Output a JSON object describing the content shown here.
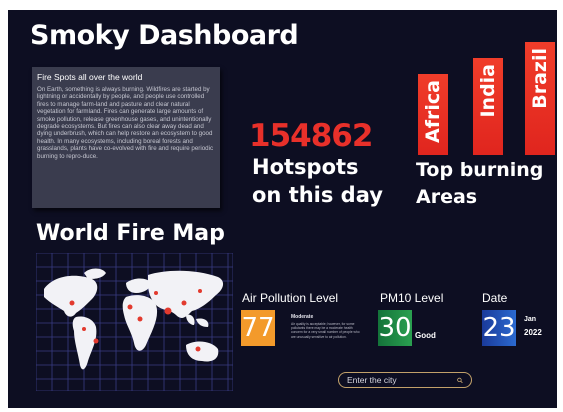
{
  "dashboard": {
    "title": "Smoky Dashboard"
  },
  "fire_card": {
    "heading": "Fire Spots all over the world",
    "body": "On Earth, something is always burning. Wildfires are started by lightning or accidentally by people, and people use controlled fires to manage farm-land and pasture and clear natural vegetation for farmland. Fires can generate large amounts of smoke pollution, release greenhouse gases, and unintentionally degrade ecosystems. But fires can also clear away dead and dying underbrush, which can help restore an ecosystem to good health. In many ecosystems, including boreal forests and grasslands, plants have co-evolved with fire and require periodic burning to repro-duce."
  },
  "hotspots": {
    "count": "154862",
    "caption_line1": "Hotspots",
    "caption_line2": "on this day"
  },
  "top_burning": {
    "bars": [
      {
        "label": "Africa",
        "level": 0.72
      },
      {
        "label": "India",
        "level": 0.86
      },
      {
        "label": "Brazil",
        "level": 1.0
      }
    ],
    "caption_line1": "Top burning",
    "caption_line2": "Areas",
    "bar_color": "#e8302a"
  },
  "map": {
    "title": "World Fire Map"
  },
  "air_pollution": {
    "label": "Air Pollution Level",
    "value": "77",
    "status": "Moderate",
    "note": "Air quality is acceptable; however, for some pollutants there may be a moderate health concern for a very small number of people who are unusually sensitive to air pollution.",
    "color": "#f39a2b"
  },
  "pm10": {
    "label": "PM10 Level",
    "value": "30",
    "status": "Good",
    "color": "#1e8a3e"
  },
  "date": {
    "label": "Date",
    "day": "23",
    "month": "Jan",
    "year": "2022",
    "color": "#1f4fb0"
  },
  "search": {
    "placeholder": "Enter the city",
    "icon": "search-icon"
  }
}
